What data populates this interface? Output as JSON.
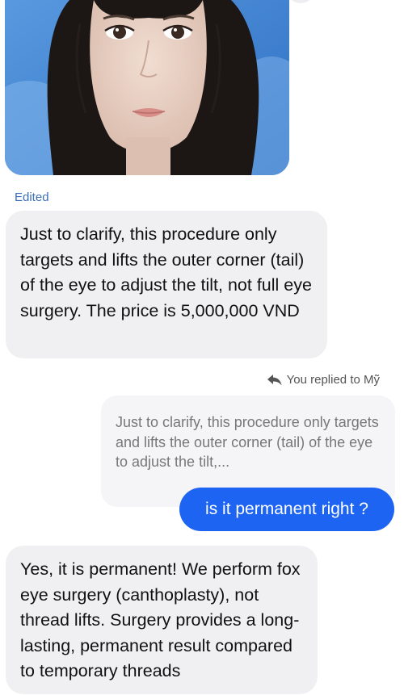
{
  "icons": {
    "reply": "reply-arrow-icon"
  },
  "colors": {
    "outgoing_bubble": "#1d64f2",
    "incoming_bubble": "#f0f0f3",
    "edited_label": "#3b6fb8"
  },
  "thread": {
    "photo_message": {
      "image_alt": "Photo of a woman with long dark hair against a blue background"
    },
    "edited_label": "Edited",
    "incoming_message_1": "Just to clarify, this procedure only targets and lifts the outer corner (tail) of the eye to adjust the tilt, not full eye surgery. The price is 5,000,000 VND",
    "reply_context": {
      "label": "You replied to Mỹ",
      "quoted_text": "Just to clarify, this procedure only targets and lifts the outer corner (tail) of the eye to adjust the tilt,..."
    },
    "outgoing_message": "is it permanent right ?",
    "incoming_message_2": "Yes, it is permanent! We perform fox eye surgery (canthoplasty), not thread lifts. Surgery provides a long-lasting, permanent result compared to temporary threads"
  }
}
